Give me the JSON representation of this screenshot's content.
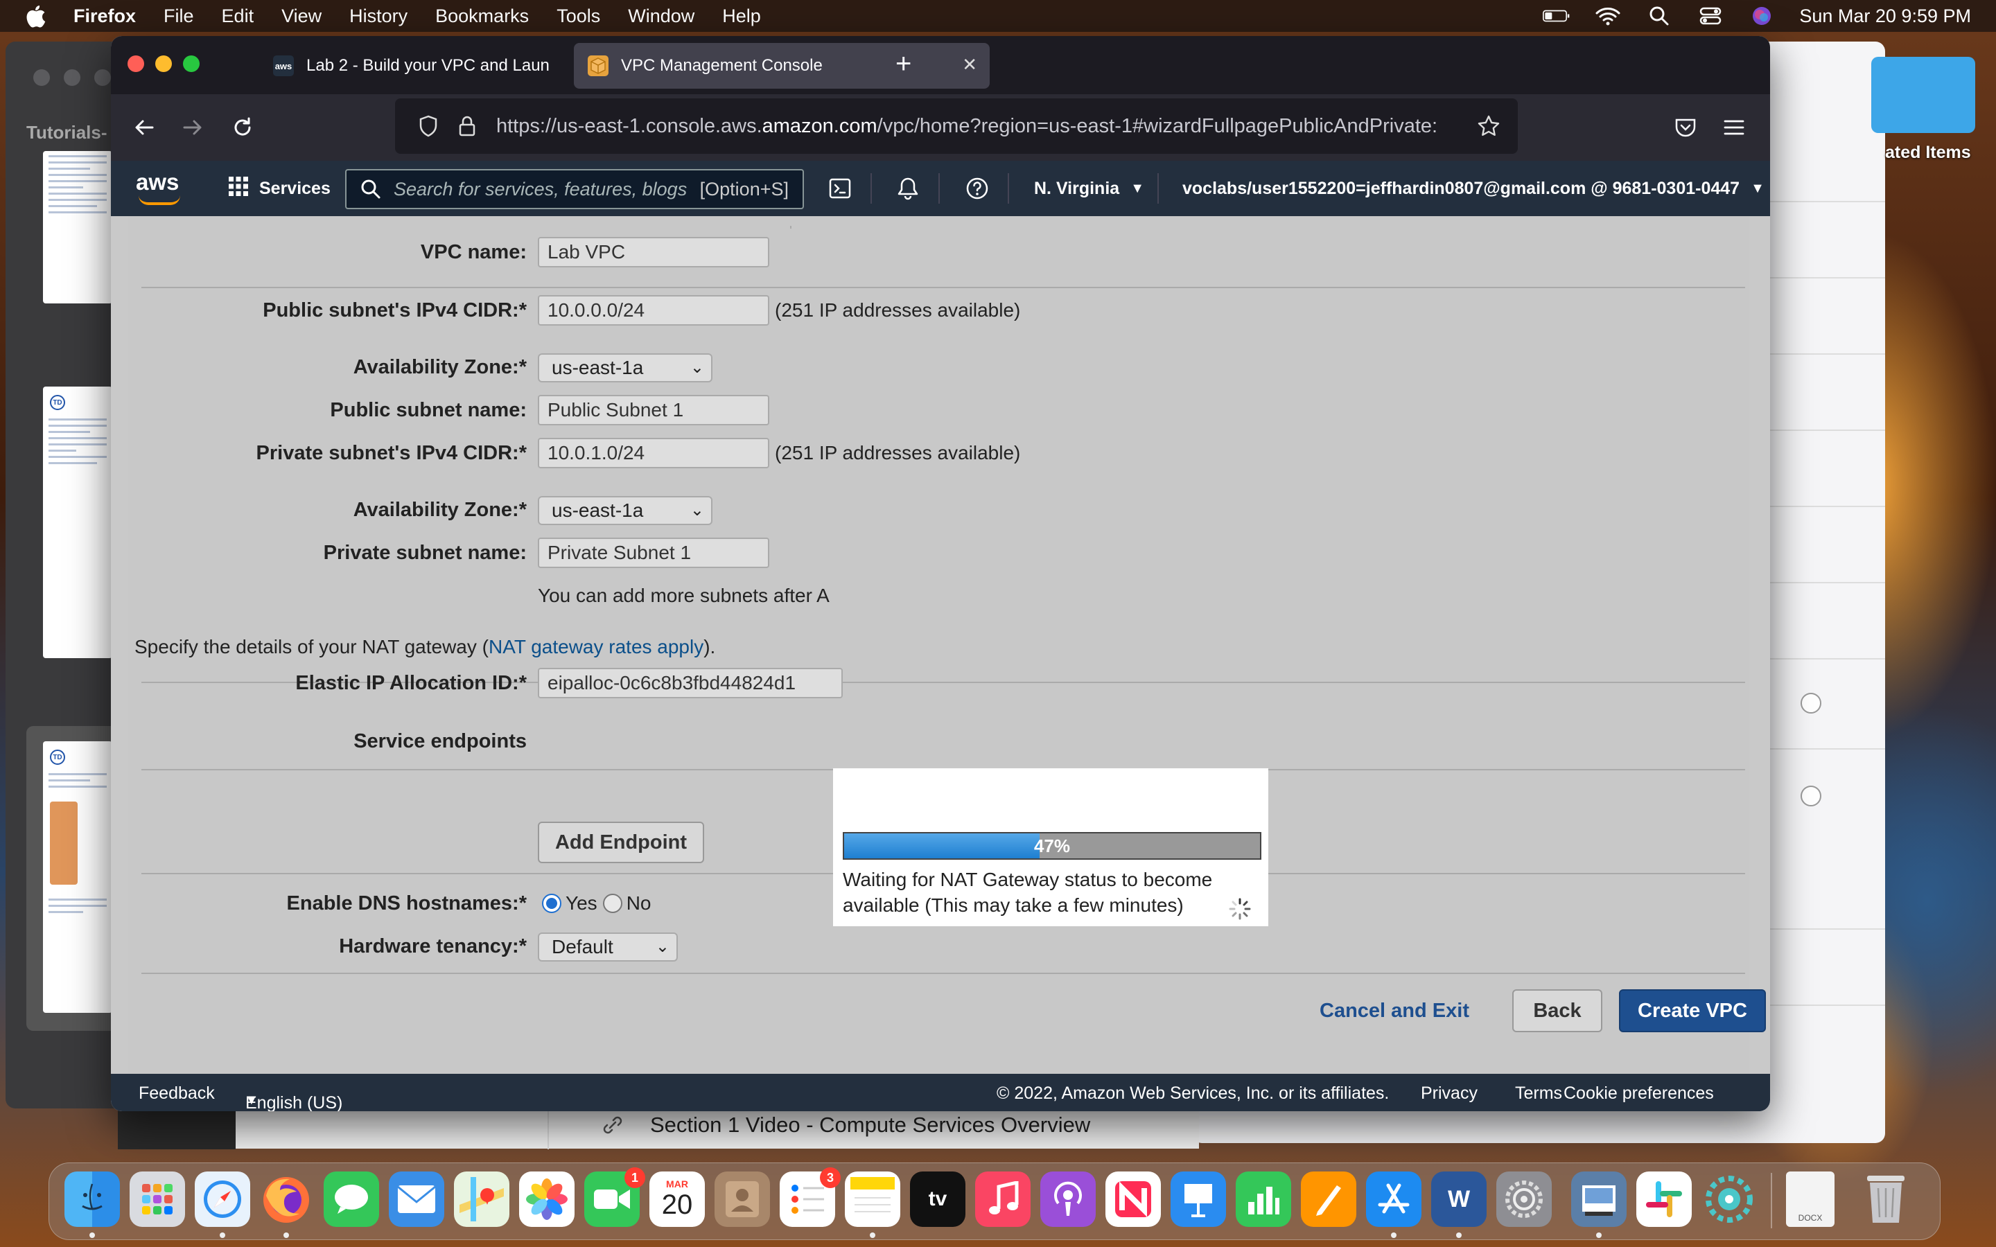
{
  "menubar": {
    "app_name": "Firefox",
    "items": [
      "File",
      "Edit",
      "View",
      "History",
      "Bookmarks",
      "Tools",
      "Window",
      "Help"
    ],
    "datetime": "Sun Mar 20  9:59 PM"
  },
  "background": {
    "sidebar_label": "Tutorials-",
    "finder_label": "ated Items",
    "bottom_text": "Section 1 Video - Compute Services Overview"
  },
  "browser": {
    "tabs": [
      {
        "title": "Lab 2 - Build your VPC and Laun",
        "active": false
      },
      {
        "title": "VPC Management Console",
        "active": true
      }
    ],
    "url_prefix": "https://us-east-1.console.aws.",
    "url_host": "amazon.com",
    "url_suffix": "/vpc/home?region=us-east-1#wizardFullpagePublicAndPrivate:"
  },
  "aws_header": {
    "logo_text": "aws",
    "services_label": "Services",
    "search_placeholder": "Search for services, features, blogs",
    "search_shortcut": "[Option+S]",
    "region": "N. Virginia",
    "account": "voclabs/user1552200=jeffhardin0807@gmail.com @ 9681-0301-0447"
  },
  "form": {
    "vpc_name_label": "VPC name:",
    "vpc_name_value": "Lab VPC",
    "public_cidr_label": "Public subnet's IPv4 CIDR:*",
    "public_cidr_value": "10.0.0.0/24",
    "public_cidr_note": "(251 IP addresses available)",
    "az1_label": "Availability Zone:*",
    "az1_value": "us-east-1a",
    "public_name_label": "Public subnet name:",
    "public_name_value": "Public Subnet 1",
    "private_cidr_label": "Private subnet's IPv4 CIDR:*",
    "private_cidr_value": "10.0.1.0/24",
    "private_cidr_note": "(251 IP addresses available)",
    "az2_label": "Availability Zone:*",
    "az2_value": "us-east-1a",
    "private_name_label": "Private subnet name:",
    "private_name_value": "Private Subnet 1",
    "subnets_note": "You can add more subnets after A",
    "nat_intro_pre": "Specify the details of your NAT gateway (",
    "nat_intro_link": "NAT gateway rates apply",
    "nat_intro_post": ").",
    "eip_label": "Elastic IP Allocation ID:*",
    "eip_value": "eipalloc-0c6c8b3fbd44824d1",
    "endpoints_label": "Service endpoints",
    "add_endpoint": "Add Endpoint",
    "dns_label": "Enable DNS hostnames:*",
    "dns_yes": "Yes",
    "dns_no": "No",
    "dns_selected": "Yes",
    "tenancy_label": "Hardware tenancy:*",
    "tenancy_value": "Default",
    "cancel": "Cancel and Exit",
    "back": "Back",
    "create": "Create VPC"
  },
  "modal": {
    "progress_percent": 47,
    "progress_text": "47%",
    "message": "Waiting for NAT Gateway status to become available (This may take a few minutes)"
  },
  "aws_footer": {
    "feedback": "Feedback",
    "language": "English (US)",
    "copyright": "© 2022, Amazon Web Services, Inc. or its affiliates.",
    "privacy": "Privacy",
    "terms": "Terms",
    "cookies": "Cookie preferences"
  },
  "dock": {
    "calendar_month": "MAR",
    "calendar_day": "20",
    "facetime_badge": "1",
    "reminders_badge": "3",
    "word_letter": "W",
    "doc_label": "DOCX",
    "tv_label": "tv"
  },
  "colors": {
    "aws_navy": "#232f3e",
    "aws_orange": "#ff9900",
    "primary_button": "#1e4f8f",
    "link": "#0b4f8a",
    "progress_blue": "#1e7fd0"
  }
}
